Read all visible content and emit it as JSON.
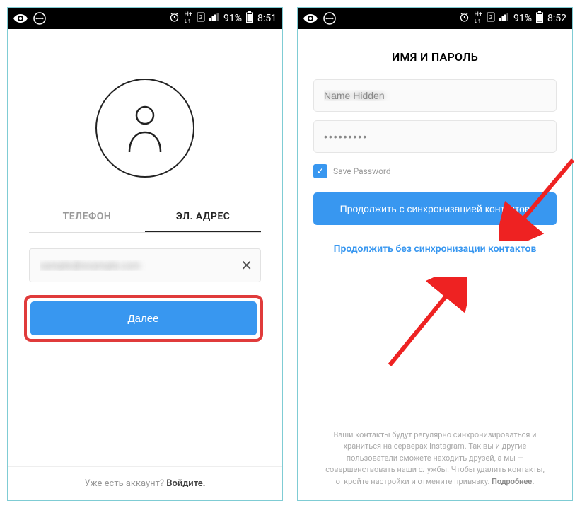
{
  "statusbar": {
    "battery": "91%",
    "time1": "8:51",
    "time2": "8:52"
  },
  "screen1": {
    "tabs": {
      "phone": "ТЕЛЕФОН",
      "email": "ЭЛ. АДРЕС"
    },
    "email_value": "sample@example.com",
    "next_button": "Далее",
    "footer_prompt": "Уже есть аккаунт? ",
    "footer_action": "Войдите."
  },
  "screen2": {
    "title": "ИМЯ И ПАРОЛЬ",
    "name_value": "Name Hidden",
    "password_value": "•••••••••",
    "save_password": "Save Password",
    "btn_sync": "Продолжить с синхронизацией контактов",
    "link_nosync": "Продолжить без синхронизации контактов",
    "disclosure": "Ваши контакты будут регулярно синхронизироваться и храниться на серверах Instagram. Так вы и другие пользователи сможете находить друзей, а мы — совершенствовать наши службы. Чтобы удалить контакты, откройте настройки и отмените привязку. ",
    "disclosure_more": "Подробнее."
  }
}
